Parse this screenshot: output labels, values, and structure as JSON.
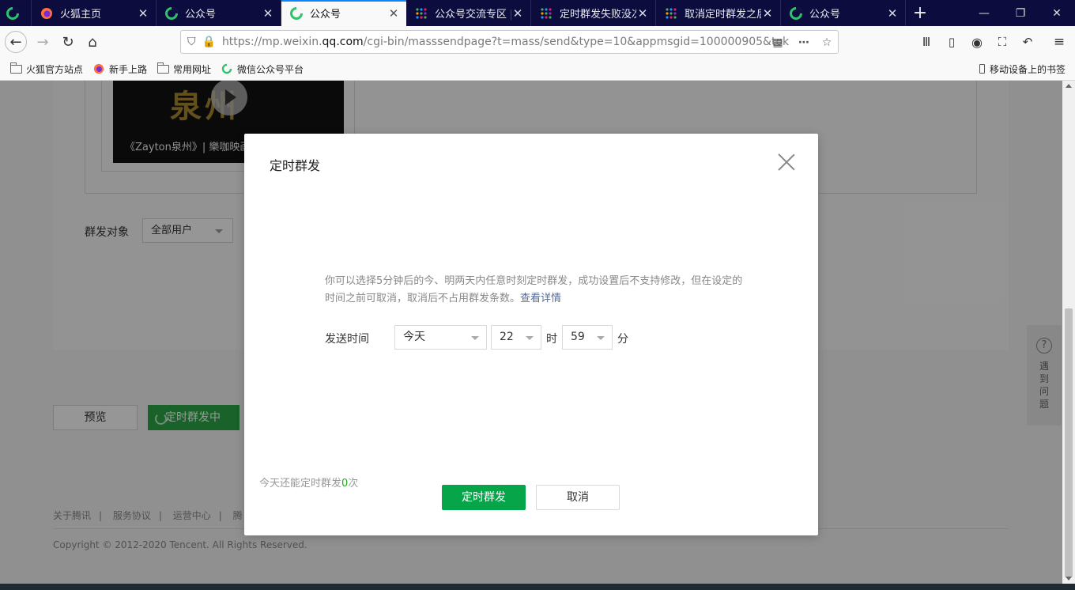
{
  "browser": {
    "tabs": [
      {
        "label": "",
        "icon": "wechat-icon"
      },
      {
        "label": "火狐主页",
        "icon": "firefox-icon"
      },
      {
        "label": "公众号",
        "icon": "wechat-icon"
      },
      {
        "label": "公众号",
        "icon": "wechat-icon",
        "active": true
      },
      {
        "label": "公众号交流专区 | 微",
        "icon": "grid-icon"
      },
      {
        "label": "定时群发失败没次数",
        "icon": "grid-icon"
      },
      {
        "label": "取消定时群发之后",
        "icon": "grid-icon"
      },
      {
        "label": "公众号",
        "icon": "wechat-icon"
      }
    ],
    "url_prefix": "https://mp.weixin.",
    "url_host": "qq.com",
    "url_rest": "/cgi-bin/masssendpage?t=mass/send&type=10&appmsgid=100000905&tok",
    "bookmarks": [
      {
        "label": "火狐官方站点",
        "icon": "folder-icon"
      },
      {
        "label": "新手上路",
        "icon": "firefox-icon"
      },
      {
        "label": "常用网址",
        "icon": "folder-icon"
      },
      {
        "label": "微信公众号平台",
        "icon": "wechat-icon"
      }
    ],
    "mobile_bookmarks": "移动设备上的书签"
  },
  "page": {
    "video_caption": "《Zayton泉州》| 樂咖映画",
    "video_overlay_text": "泉州",
    "audience_label": "群发对象",
    "audience_value": "全部用户",
    "preview_button": "预览",
    "scheduled_button": "定时群发中",
    "footer_links": [
      "关于腾讯",
      "服务协议",
      "运营中心",
      "腾"
    ],
    "copyright": "Copyright © 2012-2020 Tencent. All Rights Reserved.",
    "help_text": "遇到问题"
  },
  "dialog": {
    "title": "定时群发",
    "description": "你可以选择5分钟后的今、明两天内任意时刻定时群发，成功设置后不支持修改，但在设定的时间之前可取消，取消后不占用群发条数。",
    "details_link": "查看详情",
    "send_time_label": "发送时间",
    "day_value": "今天",
    "hour_value": "22",
    "hour_unit": "时",
    "minute_value": "59",
    "minute_unit": "分",
    "remaining_prefix": "今天还能定时群发",
    "remaining_count": "0",
    "remaining_suffix": "次",
    "confirm_button": "定时群发",
    "cancel_button": "取消"
  },
  "colors": {
    "primary_green": "#07a54a",
    "link_blue": "#576b95",
    "tab_bar": "#0c0c3e"
  }
}
